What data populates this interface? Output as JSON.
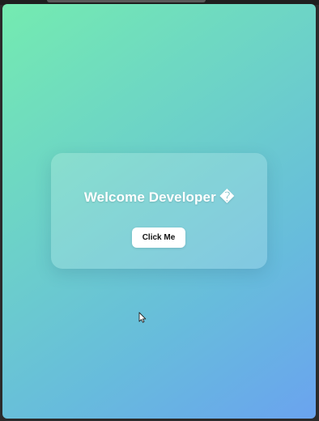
{
  "page": {
    "heading": "Welcome Developer �",
    "button_label": "Click Me"
  },
  "colors": {
    "gradient_start": "#74ebb0",
    "gradient_end": "#6aa3ef",
    "card_background": "rgba(255,255,255,0.18)",
    "button_background": "#ffffff"
  },
  "icons": {
    "cursor": "mouse-pointer-icon"
  }
}
